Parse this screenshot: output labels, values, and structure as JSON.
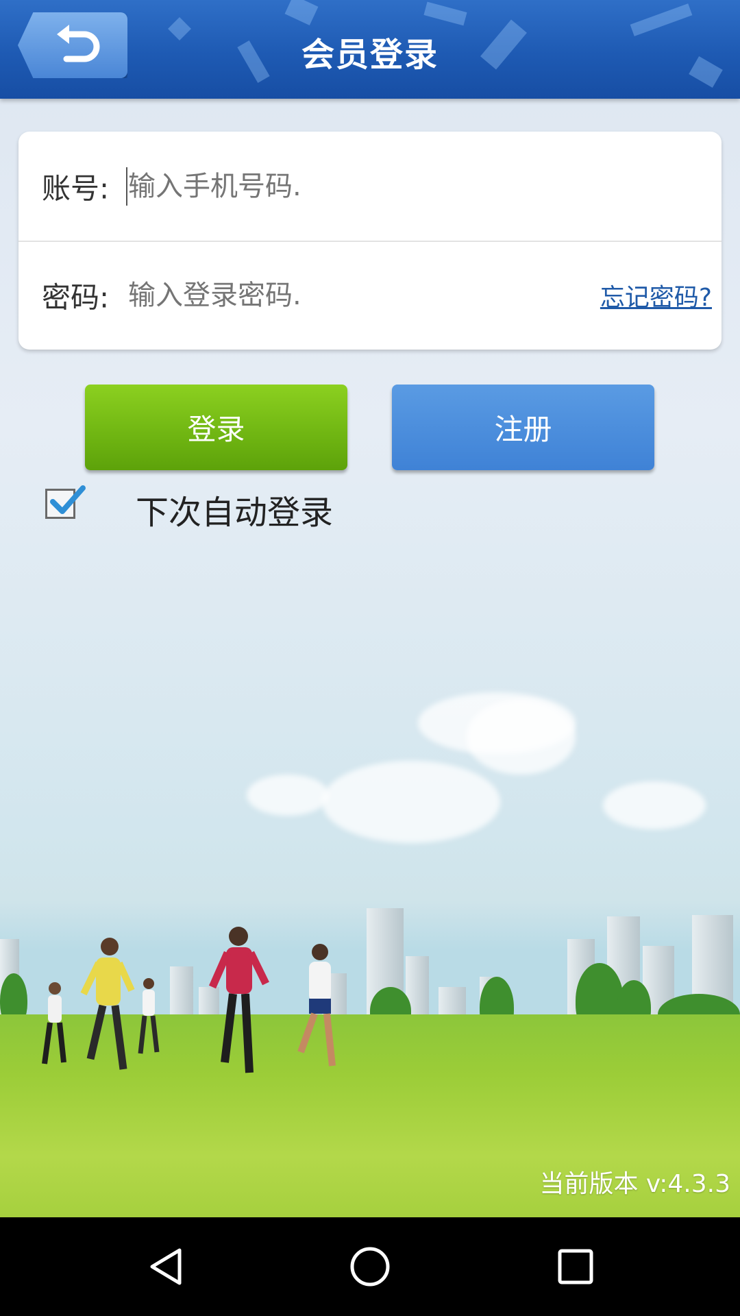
{
  "header": {
    "title": "会员登录",
    "back_icon": "back-arrow-icon"
  },
  "form": {
    "account_label": "账号:",
    "account_placeholder": "输入手机号码.",
    "password_label": "密码:",
    "password_placeholder": "输入登录密码.",
    "forgot_link": "忘记密码?"
  },
  "actions": {
    "login_label": "登录",
    "register_label": "注册"
  },
  "auto_login": {
    "label": "下次自动登录",
    "checked": true
  },
  "footer": {
    "version": "当前版本 v:4.3.3"
  },
  "colors": {
    "header": "#1e5ab3",
    "login": "#6fb512",
    "register": "#3f82d6",
    "link": "#1f5aa8"
  },
  "navbar": {
    "back": "nav-back-icon",
    "home": "nav-home-icon",
    "recents": "nav-recents-icon"
  }
}
